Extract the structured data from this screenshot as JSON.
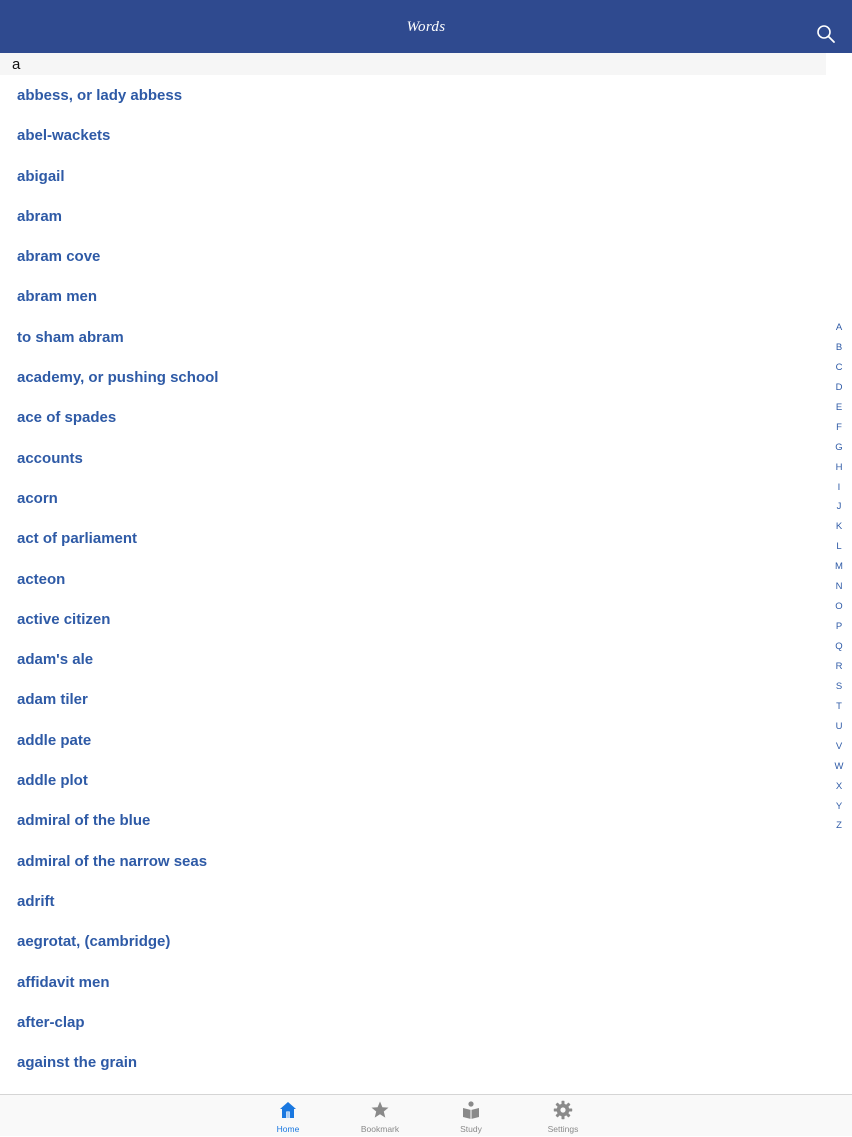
{
  "header": {
    "title": "Words",
    "search_icon": "search-icon"
  },
  "section": {
    "label": "a"
  },
  "words": [
    "abbess, or lady abbess",
    "abel-wackets",
    "abigail",
    "abram",
    "abram cove",
    "abram men",
    "to sham abram",
    "academy, or pushing school",
    "ace of spades",
    "accounts",
    "acorn",
    "act of parliament",
    "acteon",
    "active citizen",
    "adam's ale",
    "adam tiler",
    "addle pate",
    "addle plot",
    "admiral of the blue",
    "admiral of the narrow seas",
    "adrift",
    "aegrotat, (cambridge)",
    "affidavit men",
    "after-clap",
    "against the grain"
  ],
  "index": [
    "A",
    "B",
    "C",
    "D",
    "E",
    "F",
    "G",
    "H",
    "I",
    "J",
    "K",
    "L",
    "M",
    "N",
    "O",
    "P",
    "Q",
    "R",
    "S",
    "T",
    "U",
    "V",
    "W",
    "X",
    "Y",
    "Z"
  ],
  "tabs": [
    {
      "label": "Home",
      "icon": "home-icon",
      "active": true
    },
    {
      "label": "Bookmark",
      "icon": "star-icon",
      "active": false
    },
    {
      "label": "Study",
      "icon": "study-icon",
      "active": false
    },
    {
      "label": "Settings",
      "icon": "gear-icon",
      "active": false
    }
  ],
  "colors": {
    "nav_bar": "#2f4a8f",
    "word_text": "#2e5aa6",
    "tab_active": "#1a78e0",
    "tab_inactive": "#8a8a8a"
  }
}
